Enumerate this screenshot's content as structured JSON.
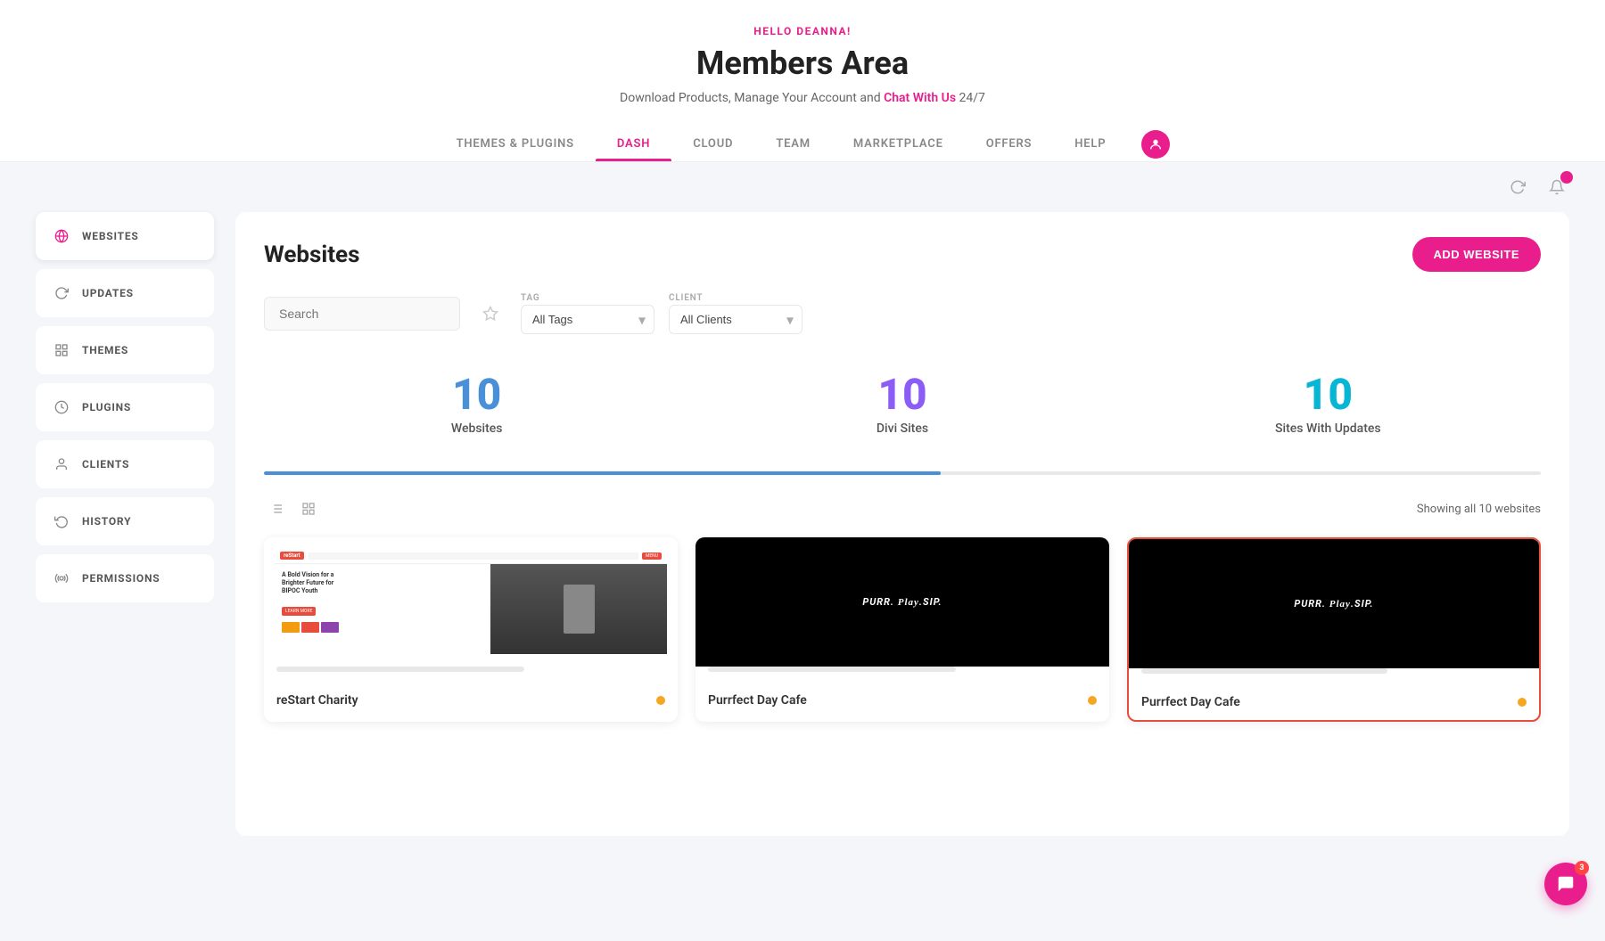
{
  "header": {
    "hello_text": "HELLO DEANNA!",
    "page_title": "Members Area",
    "subtitle_before": "Download Products, Manage Your Account and ",
    "chat_link": "Chat With Us",
    "subtitle_after": " 24/7"
  },
  "nav": {
    "tabs": [
      {
        "id": "themes",
        "label": "THEMES & PLUGINS",
        "active": false
      },
      {
        "id": "dash",
        "label": "DASH",
        "active": true
      },
      {
        "id": "cloud",
        "label": "CLOUD",
        "active": false
      },
      {
        "id": "team",
        "label": "TEAM",
        "active": false
      },
      {
        "id": "marketplace",
        "label": "MARKETPLACE",
        "active": false
      },
      {
        "id": "offers",
        "label": "OFFERS",
        "active": false
      },
      {
        "id": "help",
        "label": "HELP",
        "active": false
      }
    ]
  },
  "sidebar": {
    "items": [
      {
        "id": "websites",
        "label": "WEBSITES",
        "icon": "🌐",
        "active": true
      },
      {
        "id": "updates",
        "label": "UPDATES",
        "icon": "↻"
      },
      {
        "id": "themes",
        "label": "THEMES",
        "icon": "▣"
      },
      {
        "id": "plugins",
        "label": "PLUGINS",
        "icon": "⏰"
      },
      {
        "id": "clients",
        "label": "CLIENTS",
        "icon": "👤"
      },
      {
        "id": "history",
        "label": "HISTORY",
        "icon": "↻"
      },
      {
        "id": "permissions",
        "label": "PERMISSIONS",
        "icon": "🔧"
      }
    ]
  },
  "content": {
    "title": "Websites",
    "add_button": "ADD WEBSITE",
    "search_placeholder": "Search",
    "tag_label": "TAG",
    "tag_default": "All Tags",
    "client_label": "CLIENT",
    "client_default": "All Clients",
    "stats": [
      {
        "number": "10",
        "label": "Websites",
        "color": "blue"
      },
      {
        "number": "10",
        "label": "Divi Sites",
        "color": "purple"
      },
      {
        "number": "10",
        "label": "Sites With Updates",
        "color": "teal"
      }
    ],
    "progress_pct": 53,
    "showing_text": "Showing all 10 websites",
    "websites": [
      {
        "id": "restart",
        "name": "reStart Charity",
        "type": "restart",
        "status_dot": "orange",
        "highlighted": false
      },
      {
        "id": "purrfect1",
        "name": "Purrfect Day Cafe",
        "type": "purr",
        "status_dot": "orange",
        "highlighted": false
      },
      {
        "id": "purrfect2",
        "name": "Purrfect Day Cafe",
        "type": "purr",
        "status_dot": "orange",
        "highlighted": true
      }
    ]
  },
  "chat": {
    "badge": "3",
    "icon": "💬"
  },
  "notifications": {
    "badge": ""
  },
  "toolbar": {
    "refresh_icon": "↻",
    "bell_icon": "🔔"
  }
}
